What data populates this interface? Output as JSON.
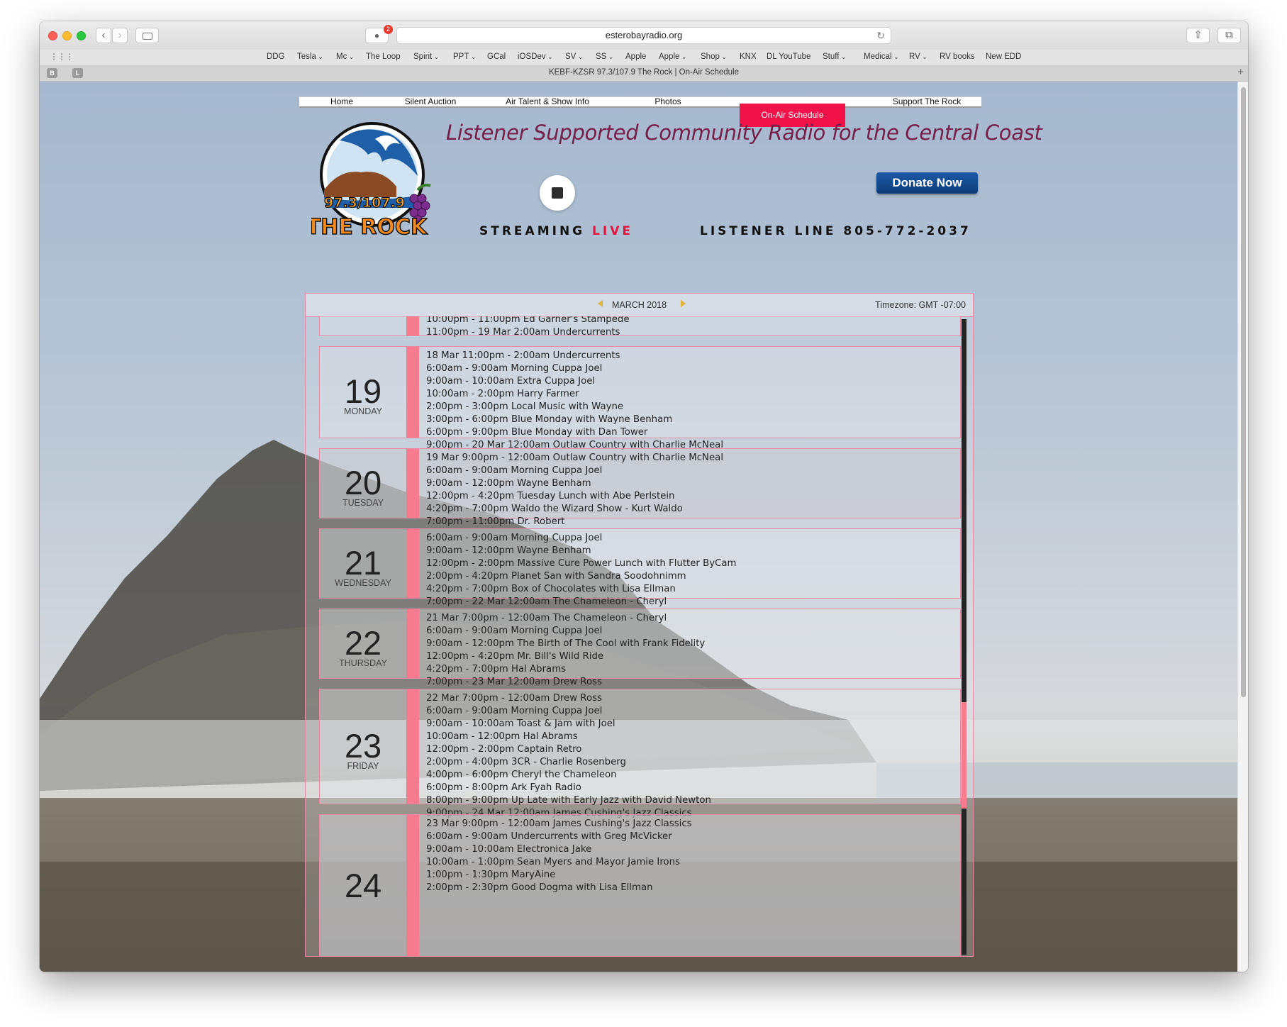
{
  "browser": {
    "url": "esterobayradio.org",
    "tab_title": "KEBF-KZSR 97.3/107.9 The Rock | On-Air Schedule",
    "notification_count": "2",
    "tab_icons": [
      "B",
      "L"
    ],
    "bookmarks": [
      {
        "label": "DDG",
        "dropdown": false
      },
      {
        "label": "Tesla",
        "dropdown": true
      },
      {
        "label": "Mc",
        "dropdown": true
      },
      {
        "label": "The Loop",
        "dropdown": false
      },
      {
        "label": "Spirit",
        "dropdown": true
      },
      {
        "label": "PPT",
        "dropdown": true
      },
      {
        "label": "GCal",
        "dropdown": false
      },
      {
        "label": "iOSDev",
        "dropdown": true
      },
      {
        "label": "SV",
        "dropdown": true
      },
      {
        "label": "SS",
        "dropdown": true
      },
      {
        "label": "Apple",
        "dropdown": false
      },
      {
        "label": "Apple",
        "dropdown": true
      },
      {
        "label": "Shop",
        "dropdown": true
      },
      {
        "label": "KNX",
        "dropdown": false
      },
      {
        "label": "DL YouTube",
        "dropdown": false
      },
      {
        "label": "Stuff",
        "dropdown": true
      },
      {
        "label": "Medical",
        "dropdown": true
      },
      {
        "label": "RV",
        "dropdown": true
      },
      {
        "label": "RV books",
        "dropdown": false
      },
      {
        "label": "New EDD",
        "dropdown": false
      }
    ]
  },
  "site": {
    "nav": [
      "Home",
      "Silent Auction",
      "Air Talent & Show Info",
      "Photos",
      "On-Air Schedule",
      "Support The Rock"
    ],
    "active_nav": "On-Air Schedule",
    "tagline": "Listener Supported Community Radio for the Central Coast",
    "logo_text_top": "97.3/107.9",
    "logo_text_bottom": "THE ROCK",
    "streaming_label": "STREAMING",
    "streaming_live": "LIVE",
    "listener_line": "LISTENER LINE 805-772-2037",
    "donate_label": "Donate Now",
    "accent_color": "#f2124a",
    "tagline_color": "#74204a"
  },
  "schedule": {
    "month_label": "MARCH 2018",
    "timezone": "Timezone: GMT -07:00",
    "days": [
      {
        "num": "",
        "name": "",
        "shows": [
          "10:00pm - 11:00pm Ed Garner's Stampede",
          "11:00pm - 19 Mar 2:00am Undercurrents"
        ]
      },
      {
        "num": "19",
        "name": "MONDAY",
        "shows": [
          "18 Mar 11:00pm - 2:00am Undercurrents",
          "6:00am - 9:00am Morning Cuppa Joel",
          "9:00am - 10:00am Extra Cuppa Joel",
          "10:00am - 2:00pm Harry Farmer",
          "2:00pm - 3:00pm Local Music with Wayne",
          "3:00pm - 6:00pm Blue Monday with Wayne Benham",
          "6:00pm - 9:00pm Blue Monday with Dan Tower",
          "9:00pm - 20 Mar 12:00am Outlaw Country with Charlie McNeal"
        ]
      },
      {
        "num": "20",
        "name": "TUESDAY",
        "shows": [
          "19 Mar 9:00pm - 12:00am Outlaw Country with Charlie McNeal",
          "6:00am - 9:00am Morning Cuppa Joel",
          "9:00am - 12:00pm Wayne Benham",
          "12:00pm - 4:20pm Tuesday Lunch with Abe Perlstein",
          "4:20pm - 7:00pm Waldo the Wizard Show - Kurt Waldo",
          "7:00pm - 11:00pm Dr. Robert"
        ]
      },
      {
        "num": "21",
        "name": "WEDNESDAY",
        "shows": [
          "6:00am - 9:00am Morning Cuppa Joel",
          "9:00am - 12:00pm Wayne Benham",
          "12:00pm - 2:00pm Massive Cure Power Lunch with Flutter ByCam",
          "2:00pm - 4:20pm Planet San with Sandra Soodohnimm",
          "4:20pm - 7:00pm Box of Chocolates with Lisa Ellman",
          "7:00pm - 22 Mar 12:00am The Chameleon - Cheryl"
        ]
      },
      {
        "num": "22",
        "name": "THURSDAY",
        "shows": [
          "21 Mar 7:00pm - 12:00am The Chameleon - Cheryl",
          "6:00am - 9:00am Morning Cuppa Joel",
          "9:00am - 12:00pm The Birth of The Cool with Frank Fidelity",
          "12:00pm - 4:20pm Mr. Bill's Wild Ride",
          "4:20pm - 7:00pm Hal Abrams",
          "7:00pm - 23 Mar 12:00am Drew Ross"
        ]
      },
      {
        "num": "23",
        "name": "FRIDAY",
        "shows": [
          "22 Mar 7:00pm - 12:00am Drew Ross",
          "6:00am - 9:00am Morning Cuppa Joel",
          "9:00am - 10:00am Toast & Jam with Joel",
          "10:00am - 12:00pm Hal Abrams",
          "12:00pm - 2:00pm Captain Retro",
          "2:00pm - 4:00pm 3CR - Charlie Rosenberg",
          "4:00pm - 6:00pm Cheryl the Chameleon",
          "6:00pm - 8:00pm Ark Fyah Radio",
          "8:00pm - 9:00pm Up Late with Early Jazz with David Newton",
          "9:00pm - 24 Mar 12:00am James Cushing's Jazz Classics"
        ]
      },
      {
        "num": "24",
        "name": "",
        "shows": [
          "23 Mar 9:00pm - 12:00am James Cushing's Jazz Classics",
          "6:00am - 9:00am Undercurrents with Greg McVicker",
          "9:00am - 10:00am Electronica Jake",
          "10:00am - 1:00pm Sean Myers and Mayor Jamie Irons",
          "1:00pm - 1:30pm MaryAine",
          "2:00pm - 2:30pm Good Dogma with Lisa Ellman"
        ]
      }
    ]
  }
}
